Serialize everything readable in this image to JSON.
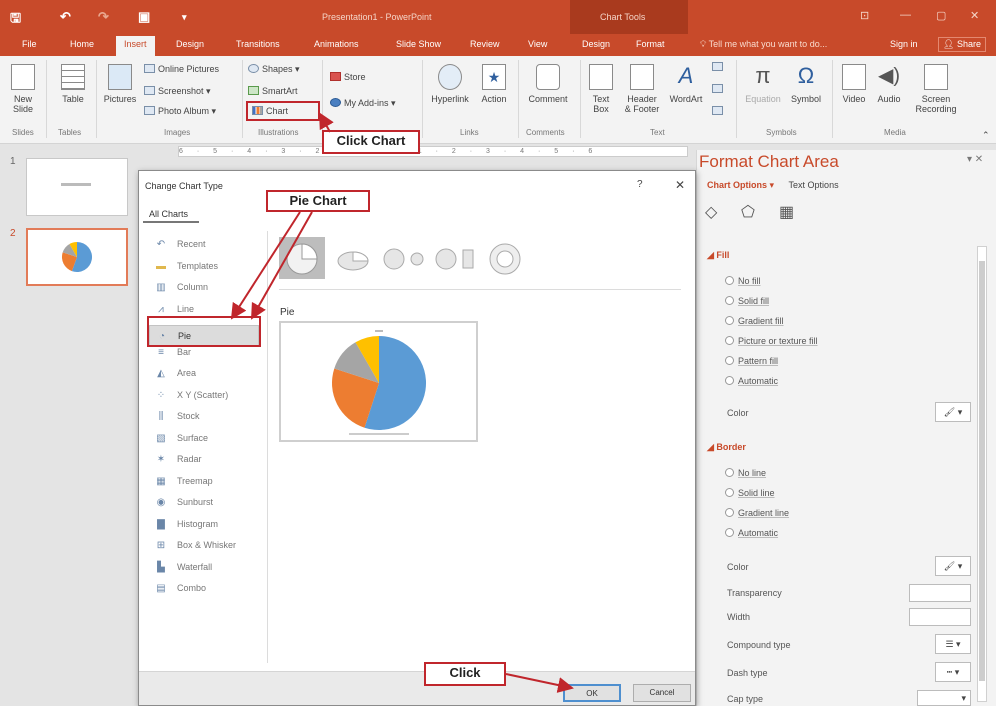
{
  "titlebar": {
    "title": "Presentation1 - PowerPoint",
    "context_title": "Chart Tools",
    "quick_access": [
      "save-icon",
      "undo-icon",
      "redo-icon",
      "start-icon",
      "customize-icon"
    ]
  },
  "tabs": [
    {
      "label": "File"
    },
    {
      "label": "Home"
    },
    {
      "label": "Insert"
    },
    {
      "label": "Design"
    },
    {
      "label": "Transitions"
    },
    {
      "label": "Animations"
    },
    {
      "label": "Slide Show"
    },
    {
      "label": "Review"
    },
    {
      "label": "View"
    },
    {
      "label": "Design"
    },
    {
      "label": "Format"
    }
  ],
  "tellme": "Tell me what you want to do...",
  "signin": "Sign in",
  "share": "Share",
  "ribbon": {
    "new_slide": "New\nSlide",
    "table": "Table",
    "pictures": "Pictures",
    "online_pictures": "Online Pictures",
    "screenshot": "Screenshot",
    "photo_album": "Photo Album",
    "shapes": "Shapes",
    "smartart": "SmartArt",
    "chart": "Chart",
    "store": "Store",
    "my_addins": "My Add-ins",
    "hyperlink": "Hyperlink",
    "action": "Action",
    "comment": "Comment",
    "text_box": "Text\nBox",
    "header_footer": "Header\n& Footer",
    "wordart": "WordArt",
    "equation": "Equation",
    "symbol": "Symbol",
    "video": "Video",
    "audio": "Audio",
    "screen_recording": "Screen\nRecording",
    "groups": {
      "slides": "Slides",
      "tables": "Tables",
      "images": "Images",
      "illustrations": "Illustrations",
      "links": "Links",
      "comments": "Comments",
      "text": "Text",
      "symbols": "Symbols",
      "media": "Media"
    }
  },
  "ruler": "6 · 5 · 4 · 3 · 2 · 1 · 0 · 1 · 2 · 3 · 4 · 5 · 6",
  "slides": [
    {
      "number": "1"
    },
    {
      "number": "2"
    }
  ],
  "dialog": {
    "title": "Change Chart Type",
    "help": "?",
    "close": "✕",
    "tab": "All Charts",
    "categories": [
      {
        "label": "Recent",
        "icon": "recent-icon"
      },
      {
        "label": "Templates",
        "icon": "folder-icon"
      },
      {
        "label": "Column",
        "icon": "column-chart-icon"
      },
      {
        "label": "Line",
        "icon": "line-chart-icon"
      },
      {
        "label": "Pie",
        "icon": "pie-chart-icon"
      },
      {
        "label": "Bar",
        "icon": "bar-chart-icon"
      },
      {
        "label": "Area",
        "icon": "area-chart-icon"
      },
      {
        "label": "X Y (Scatter)",
        "icon": "scatter-chart-icon"
      },
      {
        "label": "Stock",
        "icon": "stock-chart-icon"
      },
      {
        "label": "Surface",
        "icon": "surface-chart-icon"
      },
      {
        "label": "Radar",
        "icon": "radar-chart-icon"
      },
      {
        "label": "Treemap",
        "icon": "treemap-chart-icon"
      },
      {
        "label": "Sunburst",
        "icon": "sunburst-chart-icon"
      },
      {
        "label": "Histogram",
        "icon": "histogram-chart-icon"
      },
      {
        "label": "Box & Whisker",
        "icon": "box-whisker-chart-icon"
      },
      {
        "label": "Waterfall",
        "icon": "waterfall-chart-icon"
      },
      {
        "label": "Combo",
        "icon": "combo-chart-icon"
      }
    ],
    "selected_category": "Pie",
    "preview_name": "Pie",
    "ok": "OK",
    "cancel": "Cancel"
  },
  "format_pane": {
    "title": "Format Chart Area",
    "tab_chart_options": "Chart Options",
    "tab_text_options": "Text Options",
    "fill_header": "Fill",
    "fill_options": [
      "No fill",
      "Solid fill",
      "Gradient fill",
      "Picture or texture fill",
      "Pattern fill",
      "Automatic"
    ],
    "fill_color": "Color",
    "border_header": "Border",
    "border_options": [
      "No line",
      "Solid line",
      "Gradient line",
      "Automatic"
    ],
    "border_fields": [
      "Color",
      "Transparency",
      "Width",
      "Compound type",
      "Dash type",
      "Cap type"
    ]
  },
  "callouts": {
    "click_chart": "Click Chart",
    "pie_chart": "Pie Chart",
    "click": "Click"
  },
  "colors": {
    "accent": "#c84a2a",
    "callout_red": "#c0262c",
    "pie_blue": "#5b9bd5",
    "pie_orange": "#ed7d31",
    "pie_gray": "#a5a5a5",
    "pie_yellow": "#ffc000"
  }
}
